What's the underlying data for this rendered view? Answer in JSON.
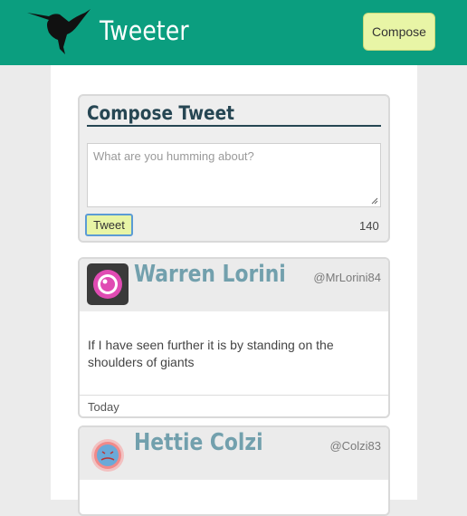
{
  "header": {
    "brand": "Tweeter",
    "compose_label": "Compose",
    "logo_icon": "hummingbird-icon"
  },
  "composer": {
    "title": "Compose Tweet",
    "placeholder": "What are you humming about?",
    "tweet_label": "Tweet",
    "char_count": "140"
  },
  "tweets": [
    {
      "name": "Warren Lorini",
      "handle": "@MrLorini84",
      "text": "If I have seen further it is by standing on the shoulders of giants",
      "date": "Today",
      "avatar_icon": "pink-robot-eye-avatar"
    },
    {
      "name": "Hettie Colzi",
      "handle": "@Colzi83",
      "avatar_icon": "blue-face-avatar"
    }
  ],
  "colors": {
    "brand": "#0b9e7f",
    "button": "#e8f5a6",
    "title": "#264653",
    "username": "#72a0ad"
  }
}
